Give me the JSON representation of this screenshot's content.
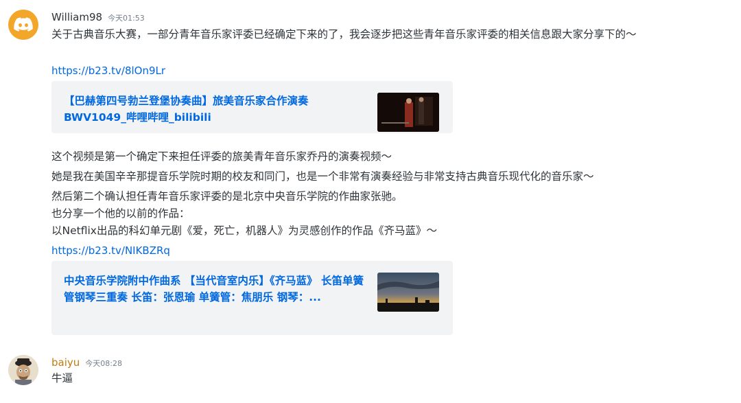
{
  "messages": [
    {
      "username": "William98",
      "timestamp": "今天01:53",
      "avatar_icon": "discord-logo-icon",
      "text_1": "关于古典音乐大赛，一部分青年音乐家评委已经确定下来的了，我会逐步把这些青年音乐家评委的相关信息跟大家分享下的～",
      "link_1": "https://b23.tv/8lOn9Lr",
      "embed_1": {
        "title": "【巴赫第四号勃兰登堡协奏曲】旅美音乐家合作演奏BWV1049_哔哩哔哩_bilibili",
        "thumbnail_icon": "concert-thumbnail"
      },
      "text_2": "这个视频是第一个确定下来担任评委的旅美青年音乐家乔丹的演奏视频～",
      "text_3": "她是我在美国辛辛那提音乐学院时期的校友和同门，也是一个非常有演奏经验与非常支持古典音乐现代化的音乐家～",
      "text_4": "然后第二个确认担任青年音乐家评委的是北京中央音乐学院的作曲家张驰。",
      "text_5": "也分享一个他的以前的作品：",
      "text_6": "以Netflix出品的科幻单元剧《爱，死亡，机器人》为灵感创作的作品《齐马蓝》～",
      "link_2": "https://b23.tv/NIKBZRq",
      "embed_2": {
        "title": "中央音乐学院附中作曲系 【当代音室内乐】《齐马蓝》 长笛单簧管钢琴三重奏 长笛：张恩瑜 单簧管：焦朋乐 钢琴：...",
        "thumbnail_icon": "sunset-landscape-thumbnail"
      }
    },
    {
      "username": "baiyu",
      "timestamp": "今天08:28",
      "avatar_icon": "cartoon-man-avatar",
      "text_1": "牛逼"
    }
  ],
  "colors": {
    "link": "#0068e0",
    "embed_bg": "#f2f3f5",
    "discord_avatar_bg": "#f2a62a",
    "baiyu_name": "#c27c0e",
    "timestamp": "#747f8d"
  }
}
